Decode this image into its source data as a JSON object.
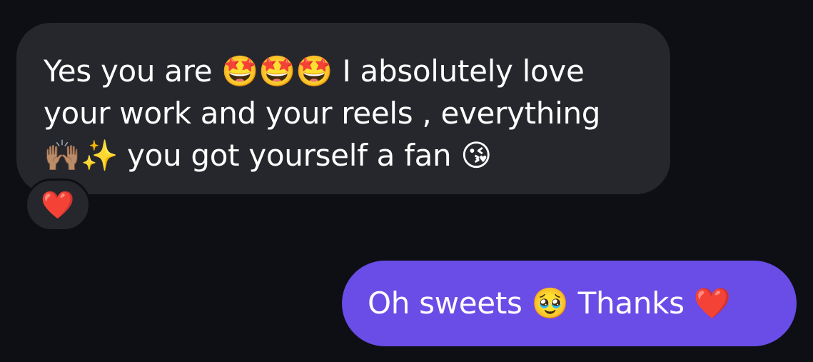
{
  "messages": [
    {
      "direction": "incoming",
      "text": "Yes you are 🤩🤩🤩 I absolutely love\nyour work and your reels , everything\n🙌🏽✨ you got yourself a fan 😘",
      "reaction": "❤️"
    },
    {
      "direction": "outgoing",
      "text": "Oh sweets 🥹 Thanks ❤️"
    }
  ],
  "colors": {
    "background": "#0d0f14",
    "incoming_bubble": "#25272c",
    "outgoing_bubble": "#6a4ce6",
    "text": "#ffffff"
  }
}
